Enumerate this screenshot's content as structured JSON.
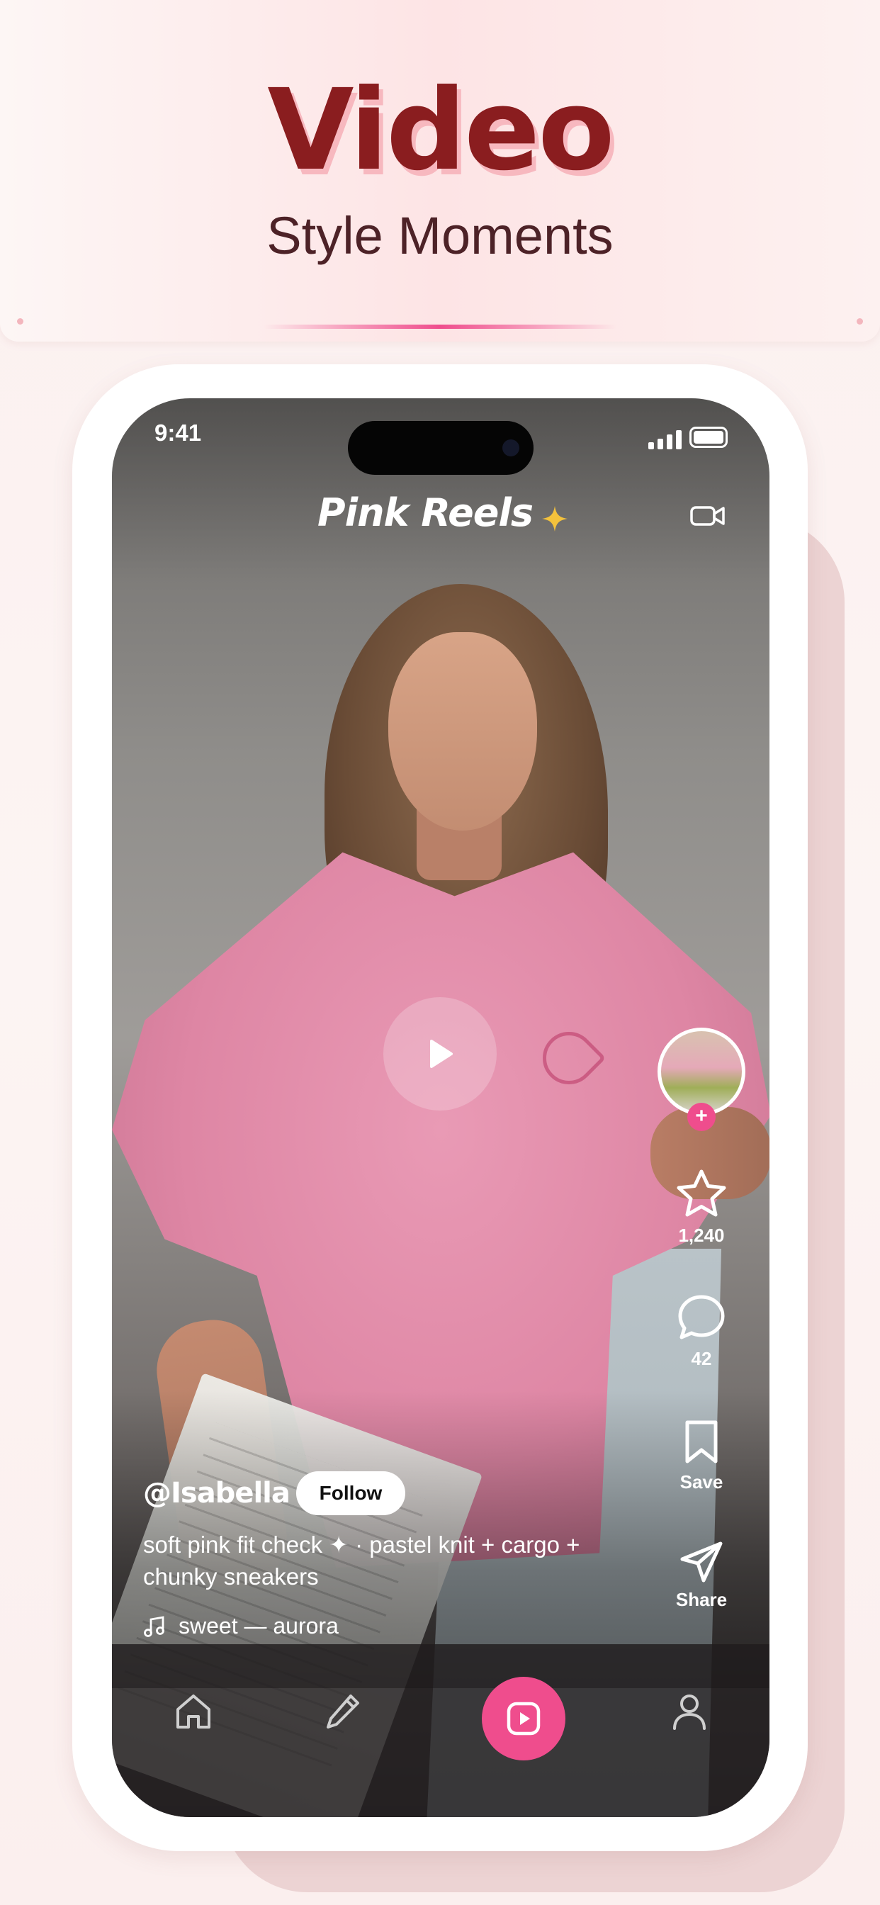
{
  "banner": {
    "headline": "Video",
    "subheadline": "Style Moments"
  },
  "status_bar": {
    "time": "9:41"
  },
  "app": {
    "title": "Pink Reels",
    "accent_color": "#ef4d8d",
    "sparkle_color": "#f4c23c"
  },
  "post": {
    "username": "@Isabella",
    "follow_label": "Follow",
    "caption": "soft pink fit check ✦ · pastel knit + cargo + chunky sneakers",
    "music": "sweet — aurora"
  },
  "actions": {
    "like_count": "1,240",
    "comment_count": "42",
    "save_label": "Save",
    "share_label": "Share"
  },
  "nav": {
    "items": [
      "home-icon",
      "edit-icon",
      "reels-icon",
      "profile-icon"
    ]
  }
}
